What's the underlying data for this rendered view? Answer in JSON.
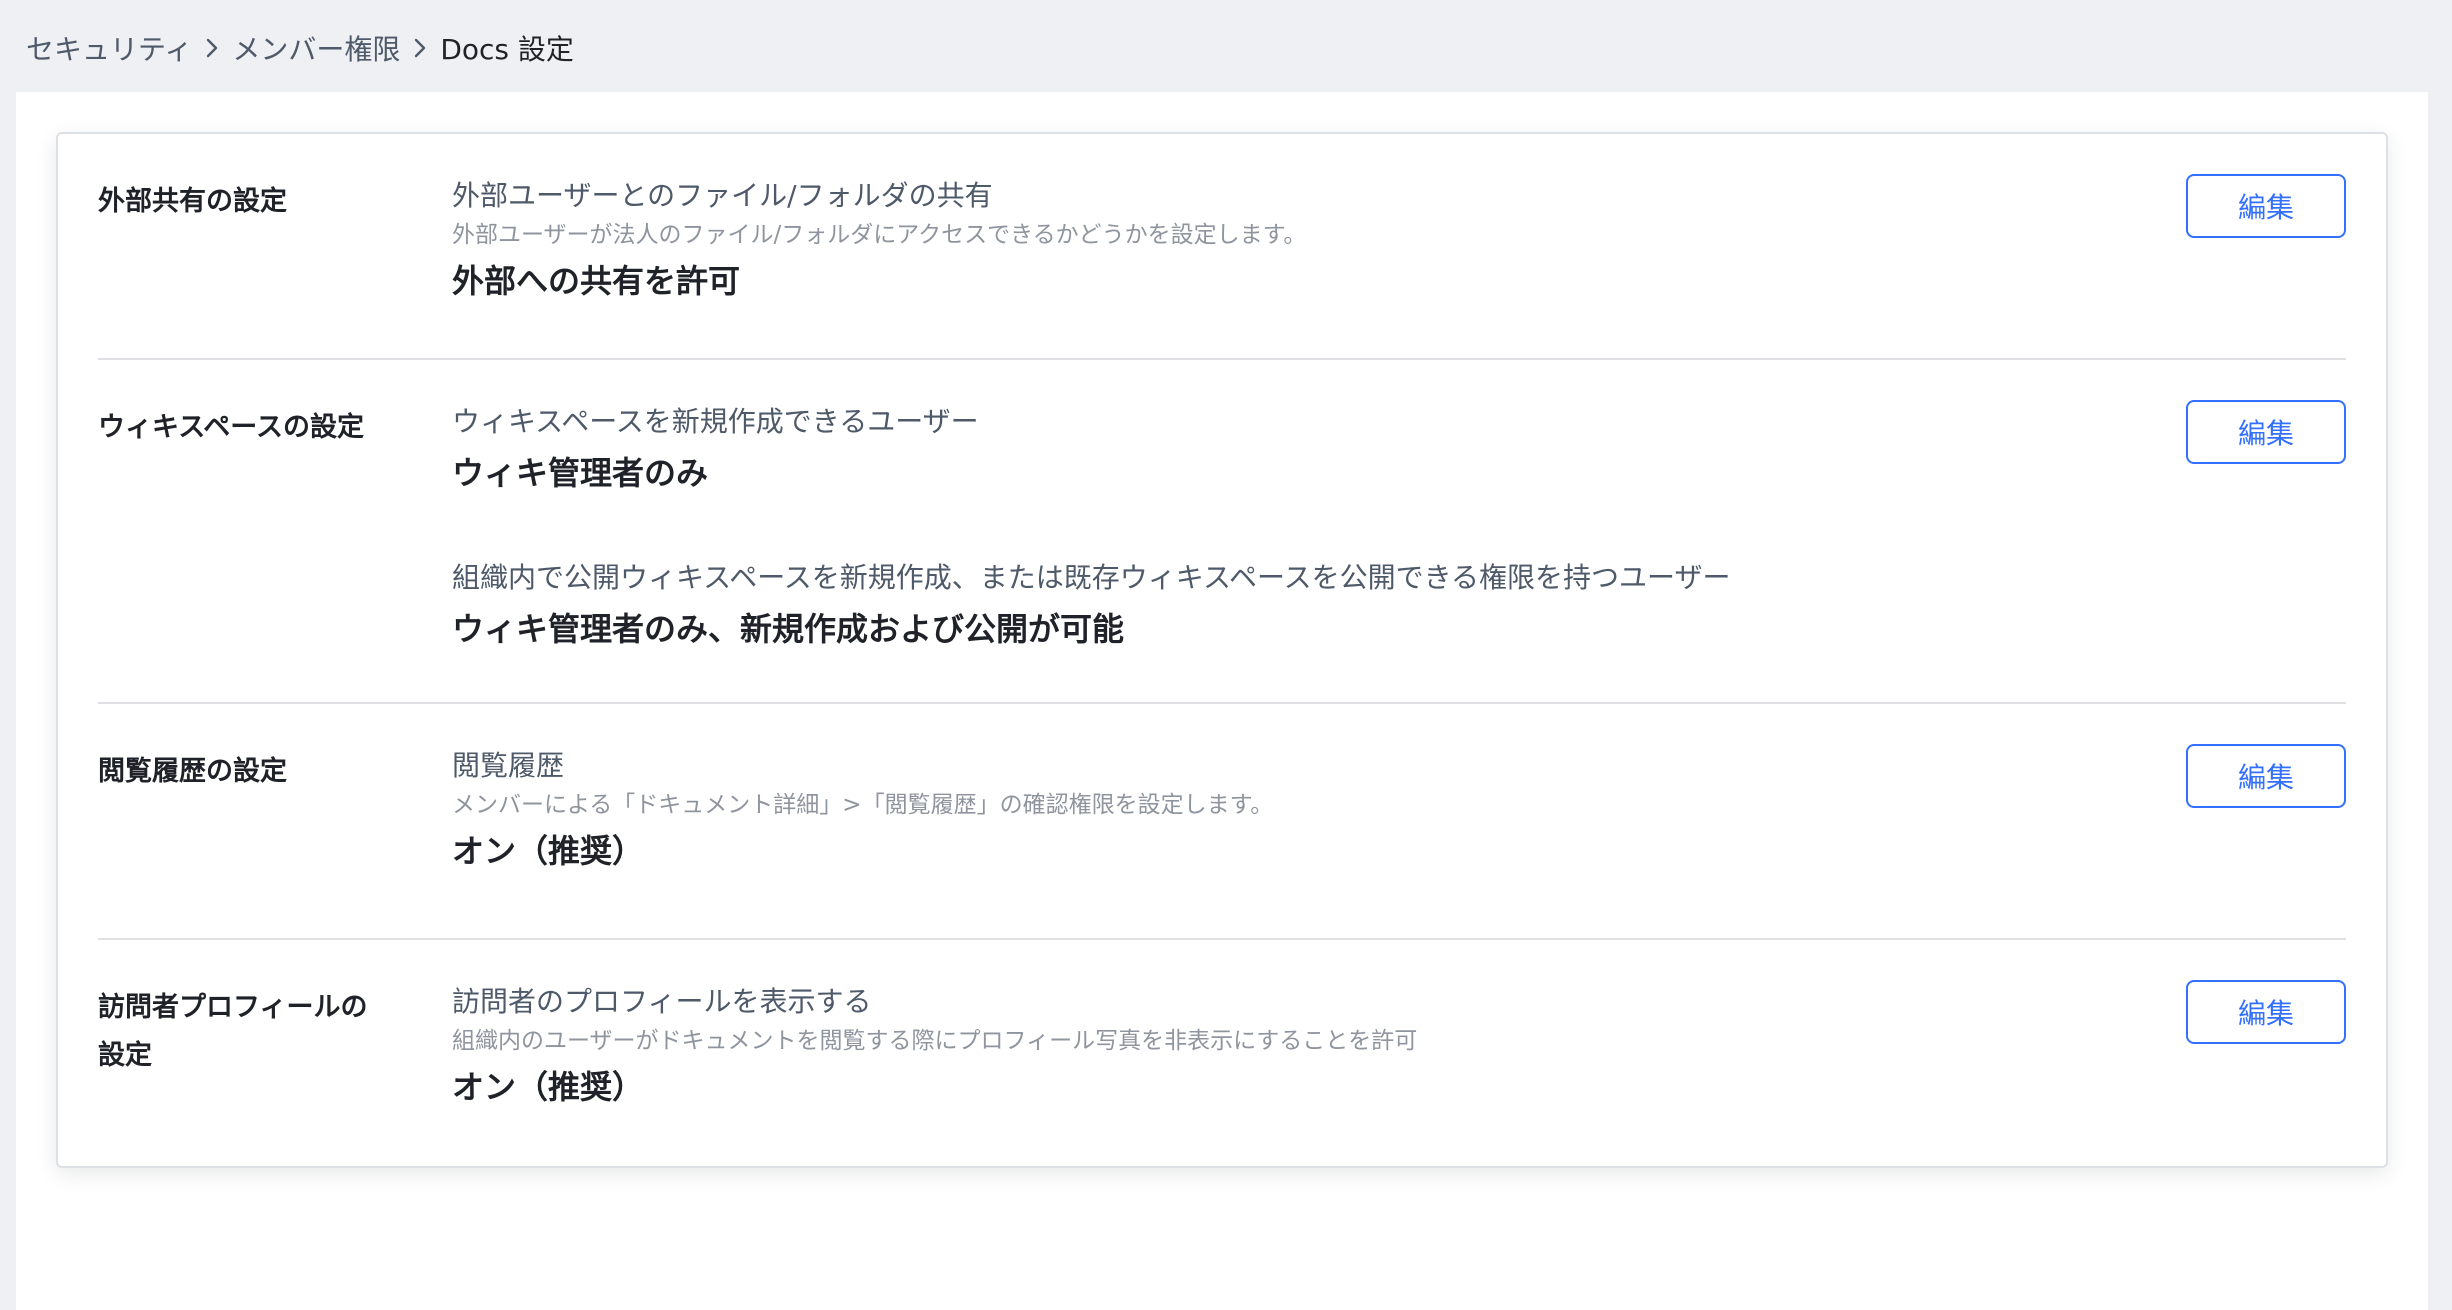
{
  "breadcrumb": {
    "items": [
      "セキュリティ",
      "メンバー権限",
      "Docs 設定"
    ],
    "separator_icon": "chevron-right-icon"
  },
  "sections": [
    {
      "title": "外部共有の設定",
      "edit_label": "編集",
      "items": [
        {
          "label": "外部ユーザーとのファイル/フォルダの共有",
          "description": "外部ユーザーが法人のファイル/フォルダにアクセスできるかどうかを設定します。",
          "value": "外部への共有を許可"
        }
      ]
    },
    {
      "title": "ウィキスペースの設定",
      "edit_label": "編集",
      "items": [
        {
          "label": "ウィキスペースを新規作成できるユーザー",
          "description": "",
          "value": "ウィキ管理者のみ"
        },
        {
          "label": "組織内で公開ウィキスペースを新規作成、または既存ウィキスペースを公開できる権限を持つユーザー",
          "description": "",
          "value": "ウィキ管理者のみ、新規作成および公開が可能"
        }
      ]
    },
    {
      "title": "閲覧履歴の設定",
      "edit_label": "編集",
      "items": [
        {
          "label": "閲覧履歴",
          "description": "メンバーによる「ドキュメント詳細」>「閲覧履歴」の確認権限を設定します。",
          "value": "オン（推奨）"
        }
      ]
    },
    {
      "title": "訪問者プロフィールの設定",
      "title_lines": [
        "訪問者プロフィールの",
        "設定"
      ],
      "edit_label": "編集",
      "items": [
        {
          "label": "訪問者のプロフィールを表示する",
          "description": "組織内のユーザーがドキュメントを閲覧する際にプロフィール写真を非表示にすることを許可",
          "value": "オン（推奨）"
        }
      ]
    }
  ],
  "colors": {
    "accent": "#3370ff",
    "background": "#eef0f3",
    "divider": "#dee0e3"
  }
}
